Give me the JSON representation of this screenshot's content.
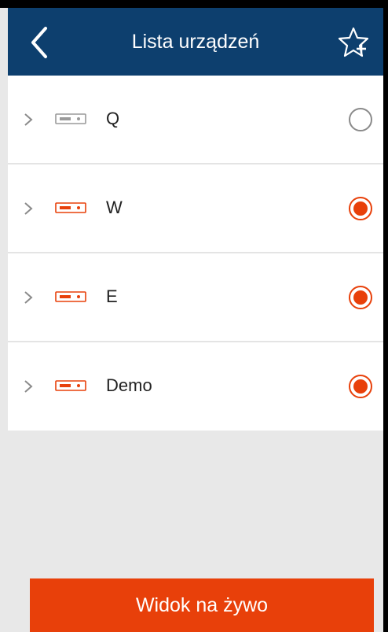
{
  "header": {
    "title": "Lista urządzeń"
  },
  "devices": [
    {
      "label": "Q",
      "selected": false
    },
    {
      "label": "W",
      "selected": true
    },
    {
      "label": "E",
      "selected": true
    },
    {
      "label": "Demo",
      "selected": true
    }
  ],
  "footer": {
    "live_view_label": "Widok na żywo"
  },
  "colors": {
    "header_bg": "#0d3f6e",
    "accent": "#e8400a",
    "inactive_icon": "#9a9a9a",
    "background": "#e8e8e8"
  },
  "icons": {
    "back": "chevron-left-icon",
    "favorite": "star-plus-icon",
    "expand": "chevron-right-icon",
    "device": "dvr-device-icon"
  }
}
